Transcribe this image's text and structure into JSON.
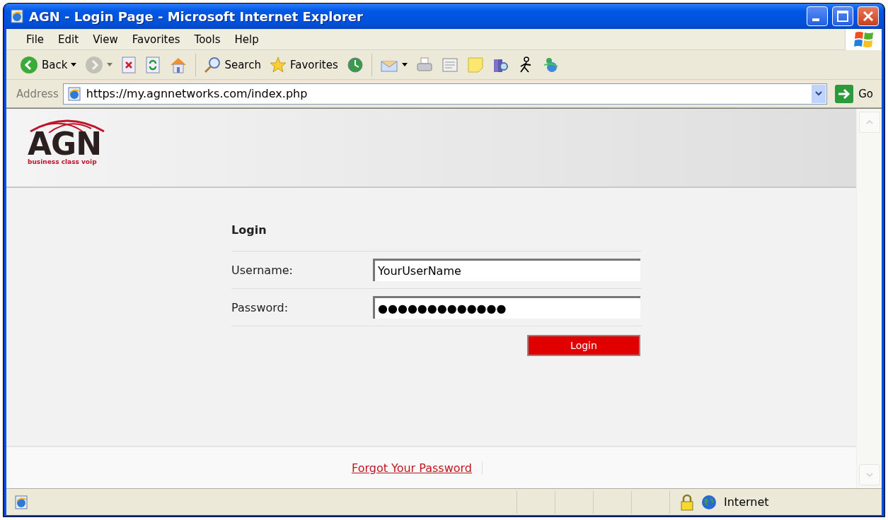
{
  "window": {
    "title": "AGN - Login Page - Microsoft Internet Explorer"
  },
  "menu": [
    "File",
    "Edit",
    "View",
    "Favorites",
    "Tools",
    "Help"
  ],
  "toolbar": [
    {
      "label": "Back",
      "disabled": false,
      "dropdown": true
    },
    {
      "disabled": true,
      "dropdown": true
    },
    {
      "disabled": false
    },
    {
      "disabled": false
    },
    {
      "disabled": false
    },
    {
      "label": "Search",
      "disabled": false,
      "separator_before": true
    },
    {
      "label": "Favorites",
      "disabled": false
    },
    {
      "disabled": false
    },
    {
      "disabled": false,
      "dropdown": true,
      "separator_before": true
    },
    {
      "disabled": false
    },
    {
      "disabled": false
    },
    {
      "disabled": false
    },
    {
      "disabled": false
    },
    {
      "disabled": false
    },
    {
      "disabled": false
    }
  ],
  "address": {
    "label": "Address",
    "value": "https://my.agnnetworks.com/index.php",
    "go": "Go"
  },
  "page": {
    "logo": {
      "name": "AGN",
      "tagline": "business class voip"
    },
    "form": {
      "title": "Login",
      "fields": [
        {
          "label": "Username:",
          "value": "YourUserName"
        },
        {
          "label": "Password:",
          "value": "●●●●●●●●●●●●●"
        }
      ],
      "submit": "Login"
    },
    "footer_link": "Forgot Your Password"
  },
  "status_bar": {
    "zone": "Internet",
    "secure": true
  }
}
